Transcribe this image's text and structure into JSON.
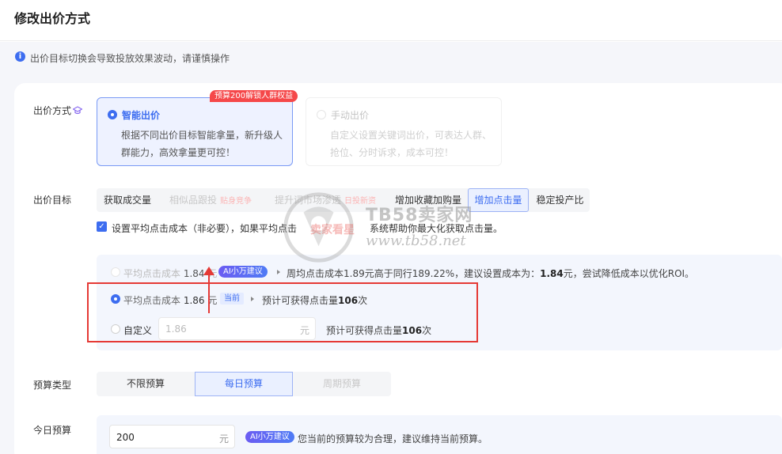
{
  "header": {
    "title": "修改出价方式"
  },
  "notice": {
    "icon": "info-icon",
    "text": "出价目标切换会导致投放效果波动，请谨慎操作"
  },
  "bid_method": {
    "label": "出价方式",
    "promo_tag": "预算200解锁人群权益",
    "smart": {
      "title": "智能出价",
      "desc_line1": "根据不同出价目标智能拿量，新升级人",
      "desc_line2": "群能力，高效拿量更可控！"
    },
    "manual": {
      "title": "手动出价",
      "desc_line1": "自定义设置关键词出价，可表达人群、",
      "desc_line2": "抢位、分时诉求，成本可控！"
    }
  },
  "bid_goal": {
    "label": "出价目标",
    "tabs": [
      {
        "label": "获取成交量",
        "tag": ""
      },
      {
        "label": "相似品跟投",
        "tag": "贴身竞争"
      },
      {
        "label": "提升词市场渗透",
        "tag": "日投新资"
      },
      {
        "label": "增加收藏加购量",
        "tag": ""
      },
      {
        "label": "增加点击量",
        "tag": ""
      },
      {
        "label": "稳定投产比",
        "tag": ""
      }
    ],
    "selected": "增加点击量",
    "checkbox_text": "设置平均点击成本（非必要），如果平均点击",
    "checkbox_text_end": "系统帮助你最大化获取点击量。"
  },
  "cost": {
    "opt1_label": "平均点击成本",
    "opt1_value": "1.84",
    "opt1_unit": "元",
    "ai_badge": "AI小万建议",
    "opt1_hint_pre": "周均点击成本1.89元高于同行189.22%，建议设置成本为：",
    "opt1_hint_val": "1.84",
    "opt1_hint_post": "元，尝试降低成本以优化ROI。",
    "opt2_label": "平均点击成本",
    "opt2_value": "1.86",
    "opt2_unit": "元",
    "current_badge": "当前",
    "opt2_hint_pre": "预计可获得点击量",
    "opt2_hint_val": "106",
    "opt2_hint_post": "次",
    "opt3_label": "自定义",
    "opt3_input": "1.86",
    "opt3_unit": "元",
    "opt3_hint_pre": "预计可获得点击量",
    "opt3_hint_val": "106",
    "opt3_hint_post": "次"
  },
  "budget_type": {
    "label": "预算类型",
    "tabs": [
      "不限预算",
      "每日预算",
      "周期预算"
    ],
    "selected": "每日预算"
  },
  "today_budget": {
    "label": "今日预算",
    "value": "200",
    "unit": "元",
    "ai_badge": "AI小万建议",
    "hint": "您当前的预算较为合理，建议维持当前预算。"
  },
  "watermark": {
    "line1": "TB58卖家网",
    "line2": "www.tb58.net",
    "overlay": "卖家看星"
  },
  "colors": {
    "primary": "#3d6df0",
    "highlight": "#e53935",
    "promo": "#f5484a"
  }
}
